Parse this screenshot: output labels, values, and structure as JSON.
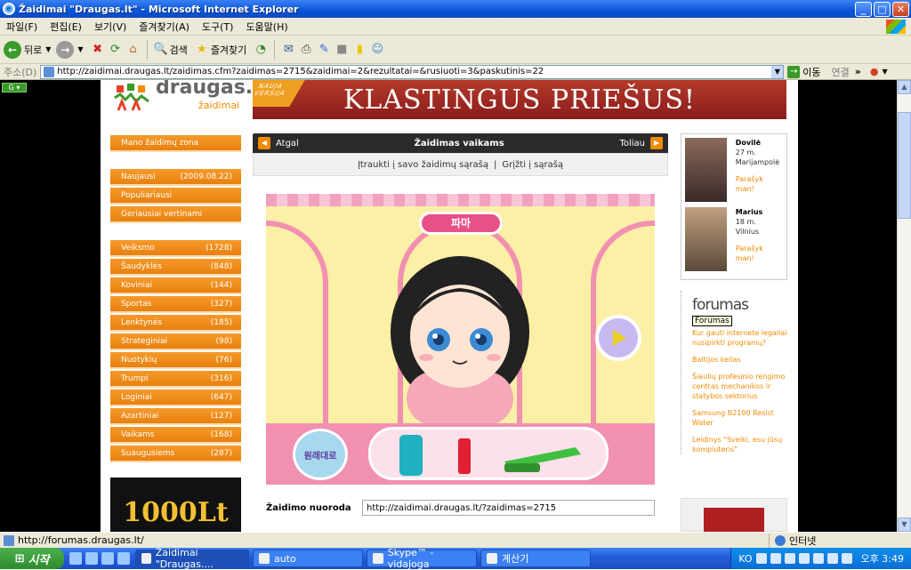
{
  "window": {
    "title": "Žaidimai \"Draugas.lt\" - Microsoft Internet Explorer",
    "minimize": "_",
    "maximize": "□",
    "close": "✕"
  },
  "menu": [
    "파일(F)",
    "편집(E)",
    "보기(V)",
    "즐겨찾기(A)",
    "도구(T)",
    "도움말(H)"
  ],
  "toolbar": {
    "back": "뒤로",
    "search": "검색",
    "favorites": "즐겨찾기"
  },
  "address": {
    "label": "주소(D)",
    "url": "http://zaidimai.draugas.lt/zaidimas.cfm?zaidimas=2715&zaidimai=2&rezultatai=&rusiuoti=3&paskutinis=22",
    "go": "이동",
    "links": "연결",
    "more": "»"
  },
  "site": {
    "logo_word": "draugas.lt",
    "logo_sub": "žaidimai",
    "banner_corner": "NAUJA VERSIJA",
    "banner_text": "KLASTINGUS PRIEŠUS!"
  },
  "leftnav": {
    "my_zone": "Mano žaidimų zona",
    "group1": [
      {
        "label": "Naujausi",
        "count": "(2009.08.22)"
      },
      {
        "label": "Populiariausi",
        "count": ""
      },
      {
        "label": "Geriausiai vertinami",
        "count": ""
      }
    ],
    "categories": [
      {
        "label": "Veiksmo",
        "count": "(1728)"
      },
      {
        "label": "Šaudyklės",
        "count": "(848)"
      },
      {
        "label": "Koviniai",
        "count": "(144)"
      },
      {
        "label": "Sportas",
        "count": "(327)"
      },
      {
        "label": "Lenktynės",
        "count": "(185)"
      },
      {
        "label": "Strateginiai",
        "count": "(98)"
      },
      {
        "label": "Nuotykių",
        "count": "(76)"
      },
      {
        "label": "Trumpi",
        "count": "(316)"
      },
      {
        "label": "Loginiai",
        "count": "(647)"
      },
      {
        "label": "Azartiniai",
        "count": "(127)"
      },
      {
        "label": "Vaikams",
        "count": "(168)"
      },
      {
        "label": "Suaugusiems",
        "count": "(287)"
      }
    ],
    "promo": "1000Lt"
  },
  "game": {
    "back": "Atgal",
    "title": "Žaidimas vaikams",
    "next": "Toliau",
    "add_link": "Įtraukti į savo žaidimų sąrašą",
    "return_link": "Grįžti į sąrašą",
    "sep": "|",
    "badge": "파마",
    "circle_label": "원래대로",
    "link_label": "Žaidimo nuoroda",
    "link_value": "http://zaidimai.draugas.lt/?zaidimas=2715"
  },
  "users": [
    {
      "name": "Dovilė",
      "age": "27 m.",
      "city": "Marijampolė",
      "action": "Parašyk man!"
    },
    {
      "name": "Marius",
      "age": "18 m.",
      "city": "Vilnius",
      "action": "Parašyk man!"
    }
  ],
  "forum": {
    "title": "forumas",
    "tooltip": "Forumas",
    "items": [
      "Kur gauti internete legaliai nusipirkti programų?",
      "Baltijos kelias",
      "Šiaulių profesinio rengimo centras mechanikos ir statybos sektorius",
      "Samsung B2100 Resist Water",
      "Leidinys \"Sveiki, esu jūsų kompiuteris\""
    ]
  },
  "status": {
    "text": "http://forumas.draugas.lt/",
    "zone": "인터넷"
  },
  "taskbar": {
    "start": "시작",
    "tasks": [
      "Žaidimai \"Draugas....",
      "auto",
      "Skype™ - vidajoga",
      "계산기"
    ],
    "lang": "KO",
    "time": "오후 3:49"
  }
}
